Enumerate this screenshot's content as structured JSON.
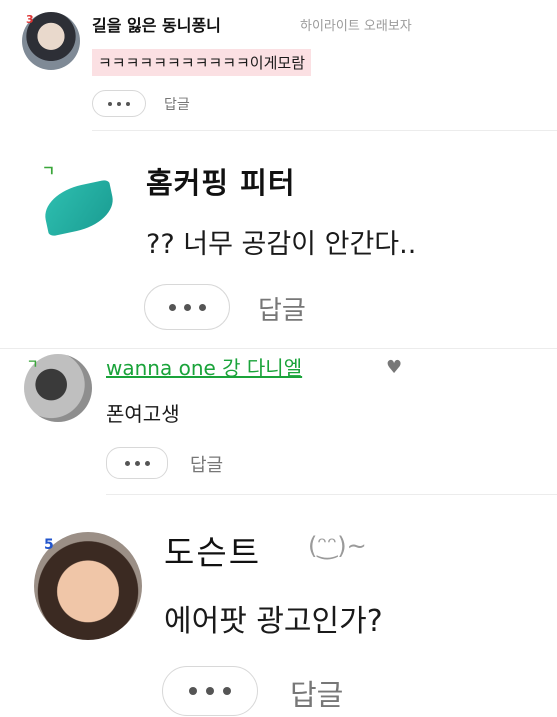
{
  "comments": [
    {
      "level": "3",
      "nickname": "길을 잃은 동니퐁니",
      "meta": "하이라이트 오래보자",
      "text": "ㅋㅋㅋㅋㅋㅋㅋㅋㅋㅋㅋ이게모람",
      "reply_label": "답글"
    },
    {
      "level": "ㄱ",
      "nickname": "홈커핑 피터",
      "text": "?? 너무 공감이 안간다..",
      "reply_label": "답글"
    },
    {
      "level": "ㄱ",
      "nickname": "wanna one 강 다니엘",
      "badge_icon": "heart-icon",
      "text": "폰여고생",
      "reply_label": "답글"
    },
    {
      "level": "5",
      "nickname": "도슨트",
      "emoticon": "(ᵔ͜ᵔ)~",
      "text": "에어팟 광고인가?",
      "reply_label": "답글"
    }
  ],
  "colors": {
    "highlight_bg": "#fbe0e3",
    "green_nick": "#1aa33a",
    "meta_gray": "#9a9a9a"
  }
}
